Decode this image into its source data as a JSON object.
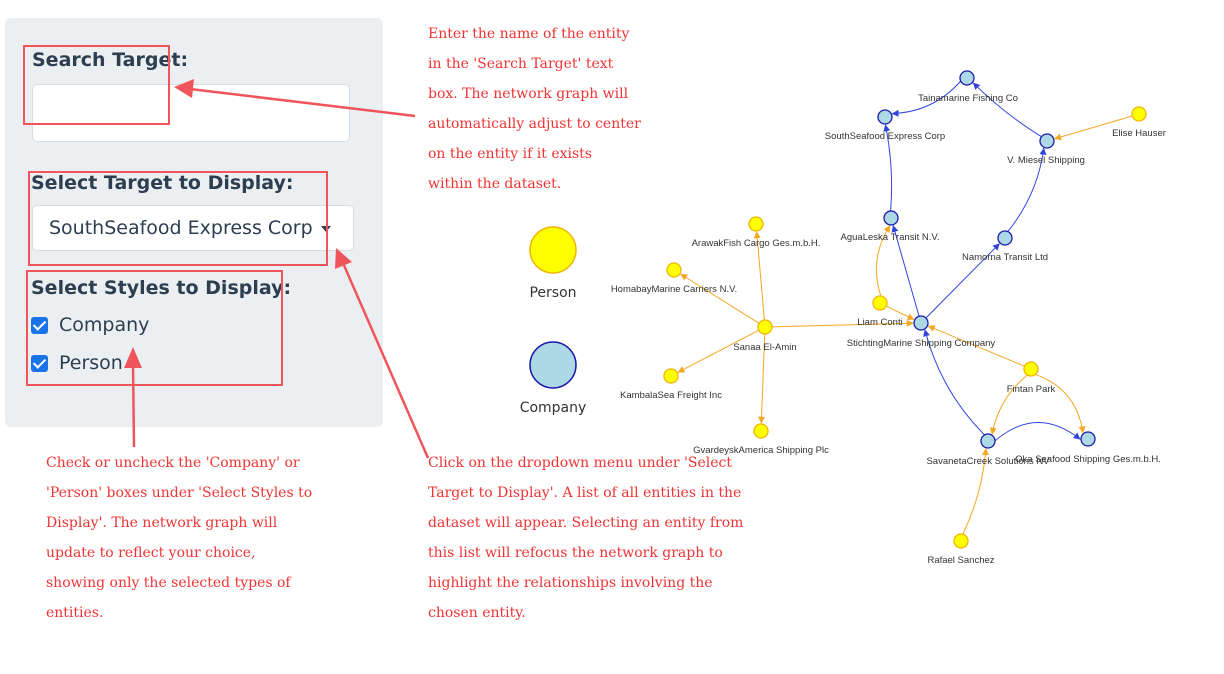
{
  "sidebar": {
    "search_label": "Search Target:",
    "search_value": "",
    "select_label": "Select Target to Display:",
    "selected_target": "SouthSeafood Express Corp",
    "styles_label": "Select Styles to Display:",
    "styles": [
      {
        "label": "Company",
        "checked": true
      },
      {
        "label": "Person",
        "checked": true
      }
    ]
  },
  "annotations": {
    "search": [
      "Enter the name of the entity",
      "in the 'Search Target' text",
      "box. The network graph will",
      "automatically adjust to center",
      "on the entity if it exists",
      "within the dataset."
    ],
    "styles": [
      "Check or uncheck the 'Company' or",
      "'Person' boxes under 'Select Styles to",
      "Display'. The network graph will",
      "update to reflect your choice,",
      "showing only the selected types of",
      "entities."
    ],
    "select": [
      "Click on the dropdown menu under 'Select",
      "Target to Display'. A list of all entities in the",
      "dataset will appear. Selecting an entity from",
      "this list will refocus the network graph to",
      "highlight the relationships involving the",
      "chosen entity."
    ]
  },
  "legend": {
    "person_label": "Person",
    "company_label": "Company",
    "person_color": "#ffff00",
    "company_color": "#add8e6"
  },
  "graph": {
    "colors": {
      "person_fill": "#ffff00",
      "person_stroke": "#f0b400",
      "company_fill": "#add8e6",
      "company_stroke": "#1a1aa8",
      "person_edge": "#f5a623",
      "company_edge": "#3344dd"
    },
    "nodes": [
      {
        "id": "tainamarine",
        "label": "Tainamarine Fishing Co",
        "type": "company"
      },
      {
        "id": "southseafood",
        "label": "SouthSeafood Express Corp",
        "type": "company"
      },
      {
        "id": "elise",
        "label": "Elise Hauser",
        "type": "person"
      },
      {
        "id": "mieser",
        "label": "V. Miesel Shipping",
        "type": "company"
      },
      {
        "id": "arawak",
        "label": "ArawakFish Cargo Ges.m.b.H.",
        "type": "person"
      },
      {
        "id": "agualeska",
        "label": "AguaLeska Transit N.V.",
        "type": "company"
      },
      {
        "id": "namorna",
        "label": "Namorna Transit Ltd",
        "type": "company"
      },
      {
        "id": "homabay",
        "label": "HomabayMarine Carriers N.V.",
        "type": "person"
      },
      {
        "id": "liam",
        "label": "Liam Conti",
        "type": "person"
      },
      {
        "id": "sanaa",
        "label": "Sanaa El-Amin",
        "type": "person"
      },
      {
        "id": "stichting",
        "label": "StichtingMarine Shipping Company",
        "type": "company"
      },
      {
        "id": "kambala",
        "label": "KambalaSea Freight Inc",
        "type": "person"
      },
      {
        "id": "fintan",
        "label": "Fintan Park",
        "type": "person"
      },
      {
        "id": "gvardeysk",
        "label": "GvardeyskAmerica Shipping Plc",
        "type": "person"
      },
      {
        "id": "savaneta",
        "label": "SavanetaCreek Solutions NV",
        "type": "company"
      },
      {
        "id": "oka",
        "label": "Oka Seafood Shipping Ges.m.b.H.",
        "type": "company"
      },
      {
        "id": "rafael",
        "label": "Rafael Sanchez",
        "type": "person"
      }
    ],
    "edges": [
      {
        "from": "tainamarine",
        "to": "southseafood",
        "type": "company"
      },
      {
        "from": "mieser",
        "to": "tainamarine",
        "type": "company"
      },
      {
        "from": "elise",
        "to": "mieser",
        "type": "person"
      },
      {
        "from": "namorna",
        "to": "mieser",
        "type": "company"
      },
      {
        "from": "stichting",
        "to": "namorna",
        "type": "company"
      },
      {
        "from": "agualeska",
        "to": "southseafood",
        "type": "company"
      },
      {
        "from": "stichting",
        "to": "agualeska",
        "type": "company"
      },
      {
        "from": "liam",
        "to": "agualeska",
        "type": "person"
      },
      {
        "from": "liam",
        "to": "stichting",
        "type": "person"
      },
      {
        "from": "sanaa",
        "to": "stichting",
        "type": "person"
      },
      {
        "from": "sanaa",
        "to": "arawak",
        "type": "person"
      },
      {
        "from": "sanaa",
        "to": "homabay",
        "type": "person"
      },
      {
        "from": "sanaa",
        "to": "kambala",
        "type": "person"
      },
      {
        "from": "sanaa",
        "to": "gvardeysk",
        "type": "person"
      },
      {
        "from": "fintan",
        "to": "stichting",
        "type": "person"
      },
      {
        "from": "fintan",
        "to": "savaneta",
        "type": "person"
      },
      {
        "from": "fintan",
        "to": "oka",
        "type": "person"
      },
      {
        "from": "savaneta",
        "to": "stichting",
        "type": "company"
      },
      {
        "from": "savaneta",
        "to": "oka",
        "type": "company"
      },
      {
        "from": "rafael",
        "to": "savaneta",
        "type": "person"
      }
    ]
  }
}
